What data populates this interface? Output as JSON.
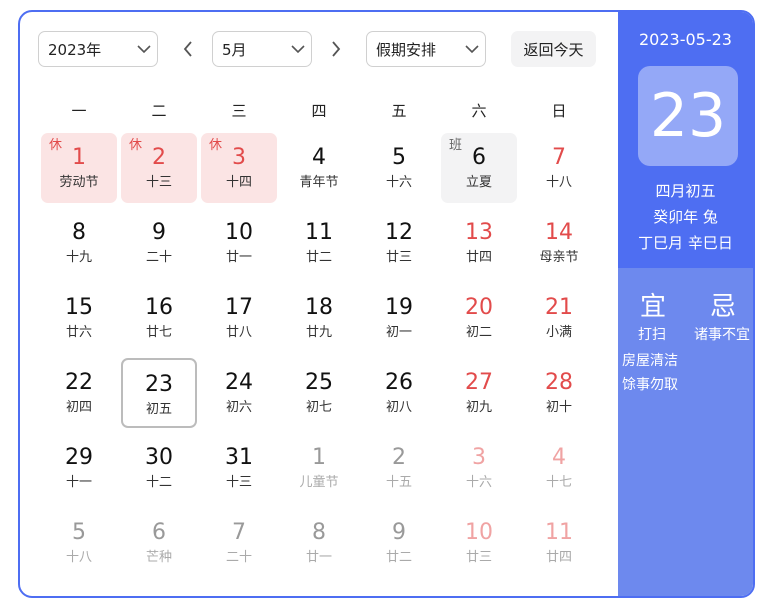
{
  "header": {
    "year": "2023年",
    "month": "5月",
    "holiday_select": "假期安排",
    "today_button": "返回今天"
  },
  "weekdays": [
    "一",
    "二",
    "三",
    "四",
    "五",
    "六",
    "日"
  ],
  "weeks": [
    [
      {
        "d": "1",
        "s": "劳动节",
        "tag": "休",
        "holiday": true,
        "weekend": false,
        "other": false
      },
      {
        "d": "2",
        "s": "十三",
        "tag": "休",
        "holiday": true,
        "weekend": false,
        "other": false
      },
      {
        "d": "3",
        "s": "十四",
        "tag": "休",
        "holiday": true,
        "weekend": false,
        "other": false
      },
      {
        "d": "4",
        "s": "青年节",
        "tag": "",
        "holiday": false,
        "weekend": false,
        "other": false
      },
      {
        "d": "5",
        "s": "十六",
        "tag": "",
        "holiday": false,
        "weekend": false,
        "other": false
      },
      {
        "d": "6",
        "s": "立夏",
        "tag": "班",
        "workday": true,
        "weekend": false,
        "other": false
      },
      {
        "d": "7",
        "s": "十八",
        "tag": "",
        "holiday": false,
        "weekend": true,
        "other": false
      }
    ],
    [
      {
        "d": "8",
        "s": "十九",
        "tag": "",
        "weekend": false,
        "other": false
      },
      {
        "d": "9",
        "s": "二十",
        "tag": "",
        "weekend": false,
        "other": false
      },
      {
        "d": "10",
        "s": "廿一",
        "tag": "",
        "weekend": false,
        "other": false
      },
      {
        "d": "11",
        "s": "廿二",
        "tag": "",
        "weekend": false,
        "other": false
      },
      {
        "d": "12",
        "s": "廿三",
        "tag": "",
        "weekend": false,
        "other": false
      },
      {
        "d": "13",
        "s": "廿四",
        "tag": "",
        "weekend": true,
        "other": false
      },
      {
        "d": "14",
        "s": "母亲节",
        "tag": "",
        "weekend": true,
        "other": false
      }
    ],
    [
      {
        "d": "15",
        "s": "廿六",
        "tag": "",
        "weekend": false,
        "other": false
      },
      {
        "d": "16",
        "s": "廿七",
        "tag": "",
        "weekend": false,
        "other": false
      },
      {
        "d": "17",
        "s": "廿八",
        "tag": "",
        "weekend": false,
        "other": false
      },
      {
        "d": "18",
        "s": "廿九",
        "tag": "",
        "weekend": false,
        "other": false
      },
      {
        "d": "19",
        "s": "初一",
        "tag": "",
        "weekend": false,
        "other": false
      },
      {
        "d": "20",
        "s": "初二",
        "tag": "",
        "weekend": true,
        "other": false
      },
      {
        "d": "21",
        "s": "小满",
        "tag": "",
        "weekend": true,
        "other": false
      }
    ],
    [
      {
        "d": "22",
        "s": "初四",
        "tag": "",
        "weekend": false,
        "other": false
      },
      {
        "d": "23",
        "s": "初五",
        "tag": "",
        "weekend": false,
        "other": false,
        "today": true
      },
      {
        "d": "24",
        "s": "初六",
        "tag": "",
        "weekend": false,
        "other": false
      },
      {
        "d": "25",
        "s": "初七",
        "tag": "",
        "weekend": false,
        "other": false
      },
      {
        "d": "26",
        "s": "初八",
        "tag": "",
        "weekend": false,
        "other": false
      },
      {
        "d": "27",
        "s": "初九",
        "tag": "",
        "weekend": true,
        "other": false
      },
      {
        "d": "28",
        "s": "初十",
        "tag": "",
        "weekend": true,
        "other": false
      }
    ],
    [
      {
        "d": "29",
        "s": "十一",
        "tag": "",
        "weekend": false,
        "other": false
      },
      {
        "d": "30",
        "s": "十二",
        "tag": "",
        "weekend": false,
        "other": false
      },
      {
        "d": "31",
        "s": "十三",
        "tag": "",
        "weekend": false,
        "other": false
      },
      {
        "d": "1",
        "s": "儿童节",
        "tag": "",
        "weekend": false,
        "other": true
      },
      {
        "d": "2",
        "s": "十五",
        "tag": "",
        "weekend": false,
        "other": true
      },
      {
        "d": "3",
        "s": "十六",
        "tag": "",
        "weekend": true,
        "other": true
      },
      {
        "d": "4",
        "s": "十七",
        "tag": "",
        "weekend": true,
        "other": true
      }
    ],
    [
      {
        "d": "5",
        "s": "十八",
        "tag": "",
        "weekend": false,
        "other": true
      },
      {
        "d": "6",
        "s": "芒种",
        "tag": "",
        "weekend": false,
        "other": true
      },
      {
        "d": "7",
        "s": "二十",
        "tag": "",
        "weekend": false,
        "other": true
      },
      {
        "d": "8",
        "s": "廿一",
        "tag": "",
        "weekend": false,
        "other": true
      },
      {
        "d": "9",
        "s": "廿二",
        "tag": "",
        "weekend": false,
        "other": true
      },
      {
        "d": "10",
        "s": "廿三",
        "tag": "",
        "weekend": true,
        "other": true
      },
      {
        "d": "11",
        "s": "廿四",
        "tag": "",
        "weekend": true,
        "other": true
      }
    ]
  ],
  "side": {
    "date": "2023-05-23",
    "day": "23",
    "lunar_date": "四月初五",
    "lunar_year": "癸卯年 兔",
    "ganzhi": "丁巳月 辛巳日",
    "yi_label": "宜",
    "ji_label": "忌",
    "yi_items": [
      "打扫",
      "房屋清洁",
      "馀事勿取"
    ],
    "ji_items": [
      "诸事不宜"
    ]
  },
  "colors": {
    "accent": "#4e6ef2",
    "side_bottom": "#6d89ee",
    "holiday_bg": "#fbe4e4",
    "weekend_text": "#e24b4b"
  }
}
